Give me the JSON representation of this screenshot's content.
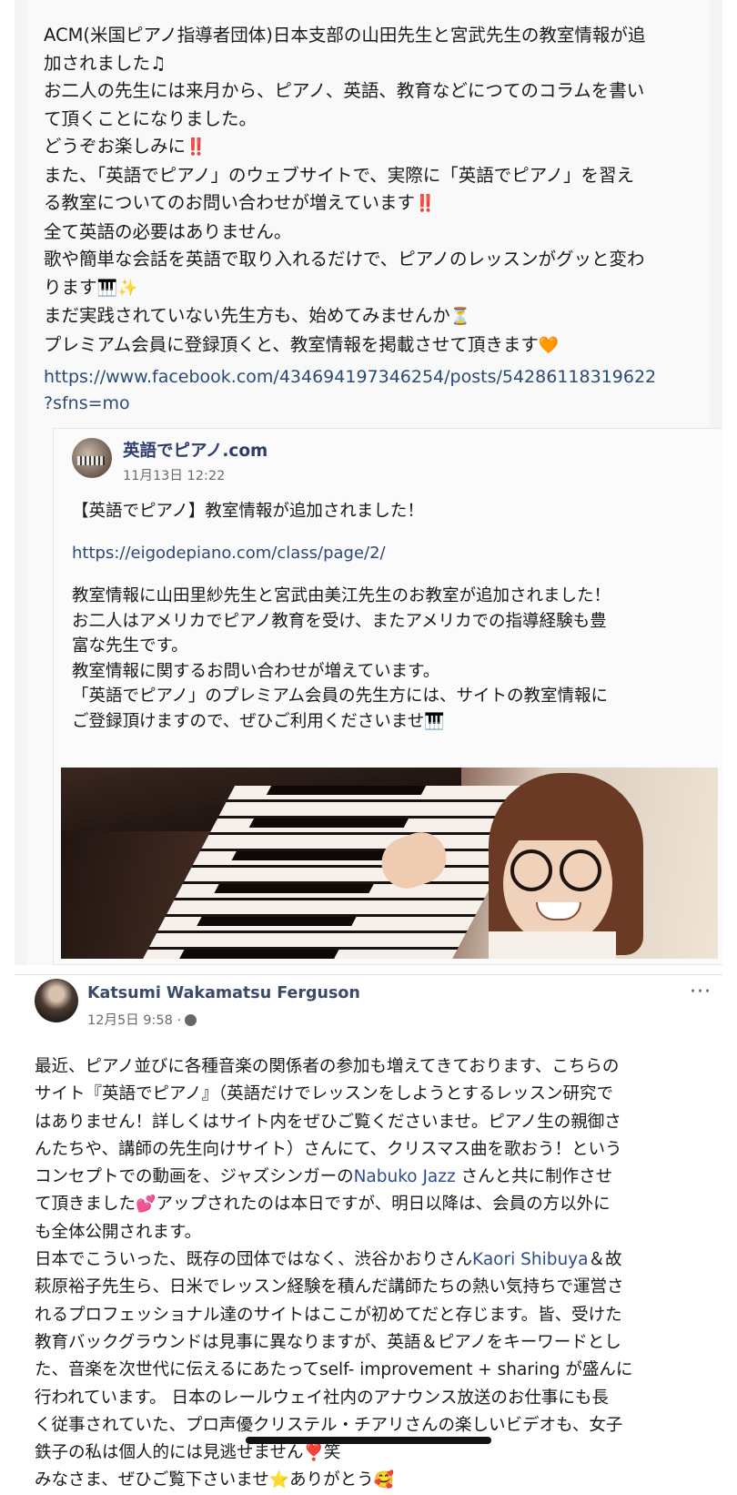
{
  "post1": {
    "lines": [
      "ACM(米国ピアノ指導者団体)日本支部の山田先生と宮武先生の教室情報が追",
      "加されました♫",
      "お二人の先生には来月から、ピアノ、英語、教育などにつてのコラムを書い",
      "て頂くことになりました。",
      "どうぞお楽しみに",
      "また、「英語でピアノ」のウェブサイトで、実際に「英語でピアノ」を習え",
      "る教室についてのお問い合わせが増えています",
      "全て英語の必要はありません。",
      "歌や簡単な会話を英語で取り入れるだけで、ピアノのレッスンがグッと変わ",
      "ります",
      "まだ実践されていない先生方も、始めてみませんか",
      "プレミアム会員に登録頂くと、教室情報を掲載させて頂きます"
    ],
    "emoji": {
      "double_exclaim": "‼️",
      "piano": "🎹",
      "sparkles": "✨",
      "hourglass": "⏳",
      "heart": "🧡"
    },
    "link_line1": "https://www.facebook.com/434694197346254/posts/54286118319622",
    "link_line2": "?sfns=mo"
  },
  "card": {
    "page_name": "英語でピアノ.com",
    "date": "11月13日 12:22",
    "title": "【英語でピアノ】教室情報が追加されました！",
    "url": "https://eigodepiano.com/class/page/2/",
    "body": [
      "教室情報に山田里紗先生と宮武由美江先生のお教室が追加されました！",
      "お二人はアメリカでピアノ教育を受け、またアメリカでの指導経験も豊",
      "富な先生です。",
      "教室情報に関するお問い合わせが増えています。",
      "「英語でピアノ」のプレミアム会員の先生方には、サイトの教室情報に",
      "ご登録頂けますので、ぜひご利用くださいませ"
    ]
  },
  "post2": {
    "author": "Katsumi Wakamatsu Ferguson",
    "date": "12月5日 9:58 ·",
    "more": "···",
    "line01": "最近、ピアノ並びに各種音楽の関係者の参加も増えてきております、こちらの",
    "line02": "サイト『英語でピアノ』（英語だけでレッスンをしようとするレッスン研究で",
    "line03": "はありません！詳しくはサイト内をぜひご覧くださいませ。ピアノ生の親御さ",
    "line04": "んたちや、講師の先生向けサイト）さんにて、クリスマス曲を歌おう！という",
    "line05a": "コンセプトでの動画を、ジャズシンガーの",
    "mention1": "Nabuko Jazz",
    "line05b": " さんと共に制作させ",
    "line06a": "て頂きました",
    "heart_emoji": "💕",
    "line06b": "アップされたのは本日ですが、明日以降は、会員の方以外に",
    "line07": "も全体公開されます。",
    "line08a": "日本でこういった、既存の団体ではなく、渋谷かおりさん",
    "mention2": "Kaori Shibuya",
    "line08b": "＆故",
    "line09": "萩原裕子先生ら、日米でレッスン経験を積んだ講師たちの熱い気持ちで運営さ",
    "line10": "れるプロフェッショナル達のサイトはここが初めてだと存じます。皆、受けた",
    "line11": "教育バックグラウンドは見事に異なりますが、英語＆ピアノをキーワードとし",
    "line12": "た、音楽を次世代に伝えるにあたってself- improvement + sharing が盛んに",
    "line13": "行われています。 日本のレールウェイ社内のアナウンス放送のお仕事にも長",
    "line14": "く従事されていた、プロ声優クリステル・チアリさんの楽しいビデオも、女子",
    "line15a": "鉄子の私は個人的には見逃せません",
    "red_exclaim": "❣️",
    "line15b": "笑",
    "line16a": "みなさま、ぜひご覧下さいませ",
    "star": "⭐",
    "line16b": "ありがとう",
    "smile": "🥰"
  },
  "colors": {
    "link": "#2a4a76",
    "name": "#2d3d6e",
    "mention": "#2d4d8a"
  }
}
